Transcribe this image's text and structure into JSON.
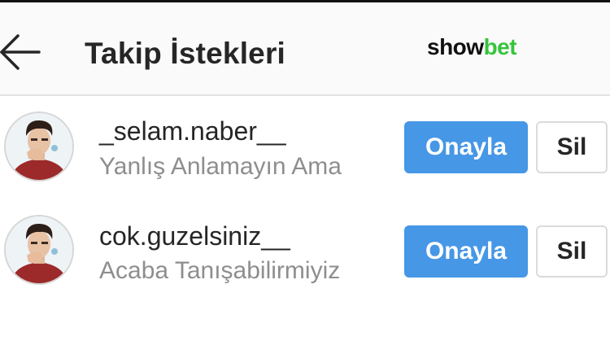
{
  "header": {
    "back_icon": "arrow-left-icon",
    "title": "Takip İstekleri",
    "brand_part1": "show",
    "brand_part2": "bet",
    "brand_colors": {
      "dark": "#111111",
      "green": "#36c43c"
    }
  },
  "requests": [
    {
      "username": "_selam.naber__",
      "subtitle": "Yanlış Anlamayın Ama",
      "approve_label": "Onayla",
      "delete_label": "Sil",
      "avatar_icon": "user-avatar-icon"
    },
    {
      "username": "cok.guzelsiniz__",
      "subtitle": "Acaba Tanışabilirmiyiz",
      "approve_label": "Onayla",
      "delete_label": "Sil",
      "avatar_icon": "user-avatar-icon"
    }
  ],
  "colors": {
    "accent": "#4697e6",
    "text": "#262626",
    "muted": "#8e8e8e",
    "header_bg": "#fafafa"
  }
}
